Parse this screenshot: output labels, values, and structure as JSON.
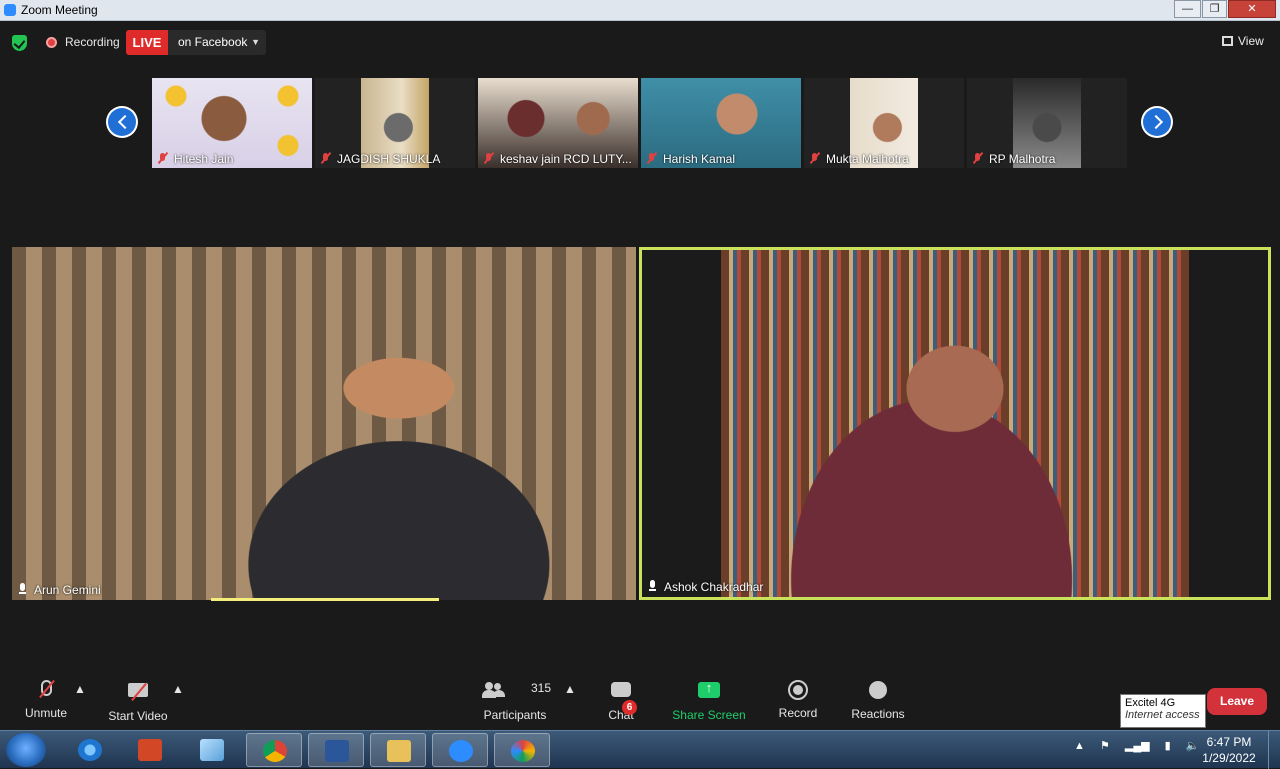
{
  "window": {
    "title": "Zoom Meeting",
    "min": "—",
    "max": "❐",
    "close": "✕"
  },
  "topbar": {
    "recording_label": "Recording",
    "live_label": "LIVE",
    "live_platform": "on Facebook",
    "view_label": "View"
  },
  "thumbnails": [
    {
      "name": "Hitesh Jain"
    },
    {
      "name": "JAGDISH SHUKLA"
    },
    {
      "name": "keshav jain RCD LUTY..."
    },
    {
      "name": "Harish Kamal"
    },
    {
      "name": "Mukta Malhotra"
    },
    {
      "name": "RP Malhotra"
    }
  ],
  "tiles": [
    {
      "name": "Arun Gemini"
    },
    {
      "name": "Ashok Chakradhar"
    }
  ],
  "controls": {
    "unmute": "Unmute",
    "start_video": "Start Video",
    "participants": "Participants",
    "participants_count": "315",
    "chat": "Chat",
    "chat_badge": "6",
    "share_screen": "Share Screen",
    "record": "Record",
    "reactions": "Reactions",
    "leave": "Leave"
  },
  "tooltip": {
    "title": "Excitel 4G",
    "subtitle": "Internet access"
  },
  "taskbar": {
    "time": "6:47 PM",
    "date": "1/29/2022"
  },
  "colors": {
    "live_red": "#e02b2b",
    "active_border": "#c9e25a",
    "share_green": "#1ece6b",
    "leave_red": "#d4323a"
  }
}
